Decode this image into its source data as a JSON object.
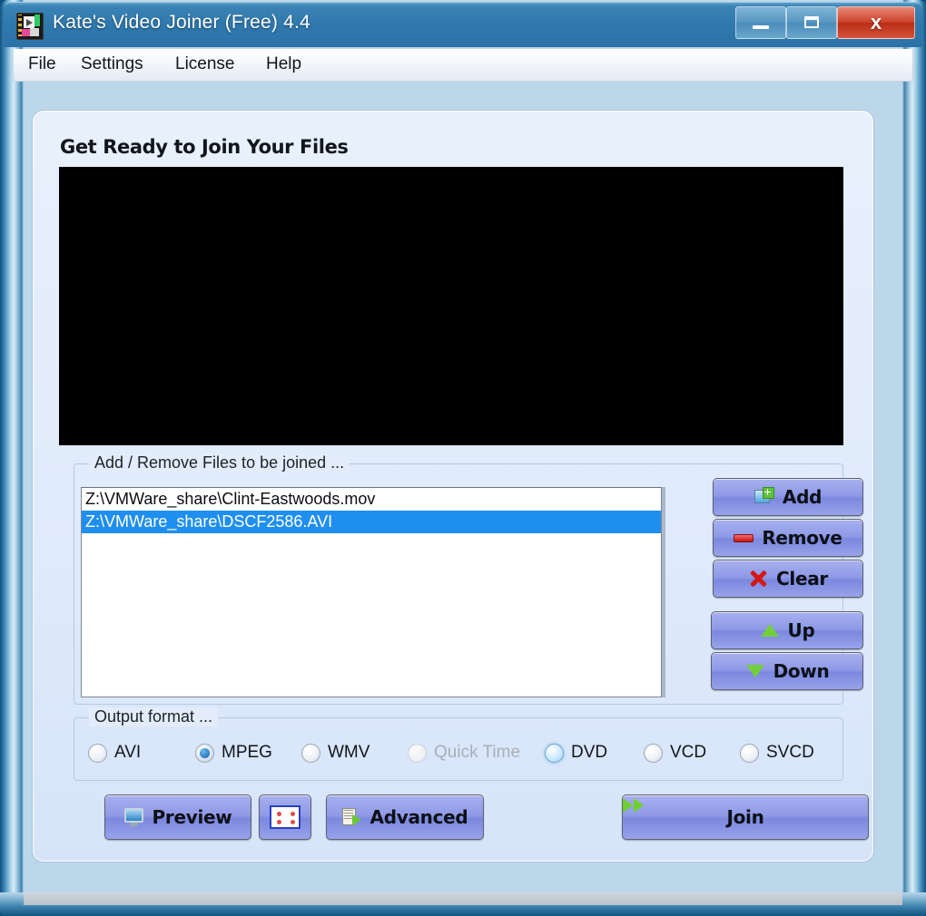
{
  "window": {
    "title": "Kate's Video Joiner (Free) 4.4",
    "app_icon": "video-joiner-icon",
    "controls": {
      "minimize": "minimize-button",
      "maximize": "maximize-button",
      "close_label": "x"
    }
  },
  "menu": {
    "items": [
      {
        "label": "File"
      },
      {
        "label": "Settings"
      },
      {
        "label": "License"
      },
      {
        "label": "Help"
      }
    ]
  },
  "panel": {
    "heading": "Get Ready to Join Your Files",
    "video_preview": "video-preview-area"
  },
  "files_group": {
    "title": "Add / Remove Files to be joined ...",
    "rows": [
      {
        "path": "Z:\\VMWare_share\\Clint-Eastwoods.mov",
        "selected": false
      },
      {
        "path": "Z:\\VMWare_share\\DSCF2586.AVI",
        "selected": true
      }
    ]
  },
  "side_buttons": {
    "add": "Add",
    "remove": "Remove",
    "clear": "Clear",
    "up": "Up",
    "down": "Down"
  },
  "format_group": {
    "title": "Output format ...",
    "options": [
      {
        "label": "AVI",
        "state": "normal"
      },
      {
        "label": "MPEG",
        "state": "checked"
      },
      {
        "label": "WMV",
        "state": "normal"
      },
      {
        "label": "Quick Time",
        "state": "disabled"
      },
      {
        "label": "DVD",
        "state": "hovered"
      },
      {
        "label": "VCD",
        "state": "normal"
      },
      {
        "label": "SVCD",
        "state": "normal"
      }
    ],
    "selected": "MPEG"
  },
  "bottom_buttons": {
    "preview": "Preview",
    "filmstrip": "filmstrip-button",
    "advanced": "Advanced",
    "join": "Join"
  },
  "colors": {
    "title_bar": "#2f78ad",
    "close_button": "#c2301a",
    "panel_bg": "#e3ecfb",
    "button_face": "#8f9ae6",
    "selection": "#1f8fef",
    "accent_green": "#6fd12f",
    "accent_red": "#d31818"
  }
}
